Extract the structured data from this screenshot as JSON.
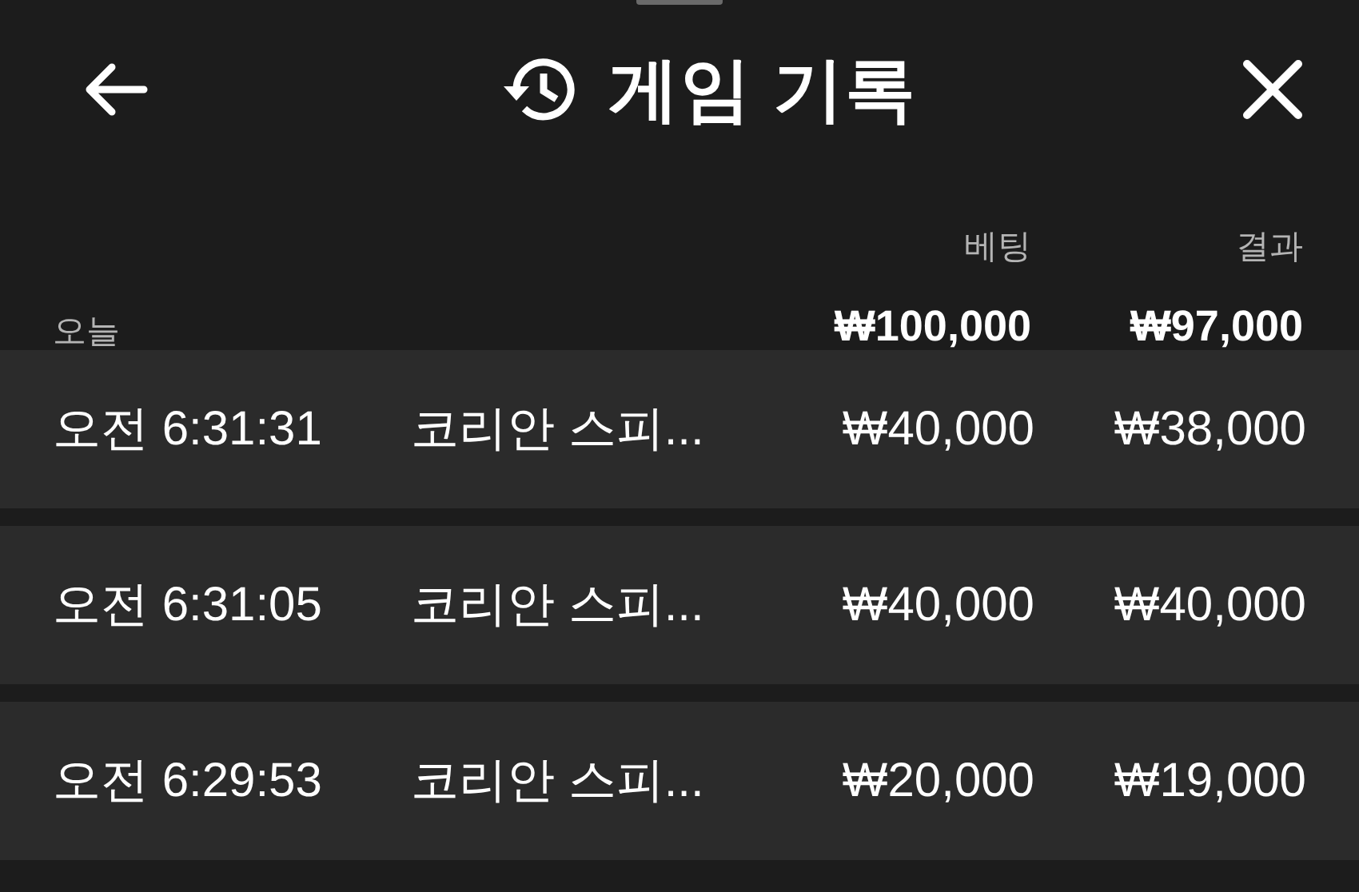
{
  "header": {
    "title": "게임 기록"
  },
  "columns": [
    {
      "label": "베팅"
    },
    {
      "label": "결과"
    }
  ],
  "summary": {
    "label": "오늘",
    "bet": "₩100,000",
    "result": "₩97,000"
  },
  "rows": [
    {
      "time": "오전 6:31:31",
      "game": "코리안 스피...",
      "bet": "₩40,000",
      "result": "₩38,000"
    },
    {
      "time": "오전 6:31:05",
      "game": "코리안 스피...",
      "bet": "₩40,000",
      "result": "₩40,000"
    },
    {
      "time": "오전 6:29:53",
      "game": "코리안 스피...",
      "bet": "₩20,000",
      "result": "₩19,000"
    }
  ]
}
